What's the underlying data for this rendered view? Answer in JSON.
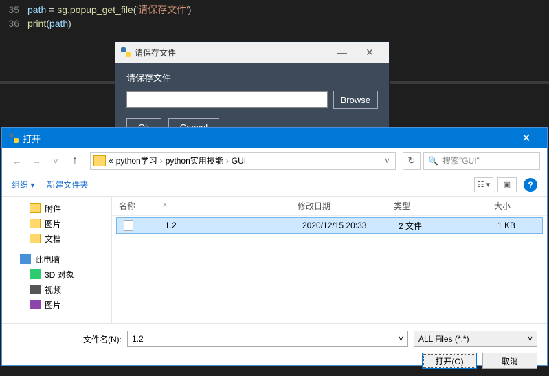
{
  "code": {
    "lines": [
      {
        "num": "35",
        "var": "path",
        "fn": "sg.popup_get_file",
        "arg": "'请保存文件'"
      },
      {
        "num": "36",
        "builtin": "print",
        "arg2": "path"
      }
    ]
  },
  "popup": {
    "title": "请保存文件",
    "prompt": "请保存文件",
    "browse": "Browse",
    "ok": "Ok",
    "cancel": "Cancel"
  },
  "dialog": {
    "title": "打开",
    "breadcrumb_prefix": "«",
    "crumbs": [
      "python学习",
      "python实用技能",
      "GUI"
    ],
    "search_placeholder": "搜索\"GUI\"",
    "organize": "组织 ▾",
    "new_folder": "新建文件夹",
    "view_btn": "☷ ▾",
    "preview_btn": "▣",
    "sidebar": [
      {
        "label": "附件",
        "class": "folder",
        "sub": true
      },
      {
        "label": "图片",
        "class": "folder",
        "sub": true
      },
      {
        "label": "文档",
        "class": "folder",
        "sub": true
      },
      {
        "label": "此电脑",
        "class": "pc",
        "sub": false
      },
      {
        "label": "3D 对象",
        "class": "obj3d",
        "sub": true
      },
      {
        "label": "视频",
        "class": "video",
        "sub": true
      },
      {
        "label": "图片",
        "class": "pic",
        "sub": true
      }
    ],
    "columns": {
      "name": "名称",
      "date": "修改日期",
      "type": "类型",
      "size": "大小"
    },
    "rows": [
      {
        "name": "1.2",
        "date": "2020/12/15 20:33",
        "type": "2 文件",
        "size": "1 KB"
      }
    ],
    "filename_label": "文件名(N):",
    "filename_value": "1.2",
    "filter": "ALL Files (*.*)",
    "open_btn": "打开(O)",
    "cancel_btn": "取消"
  }
}
